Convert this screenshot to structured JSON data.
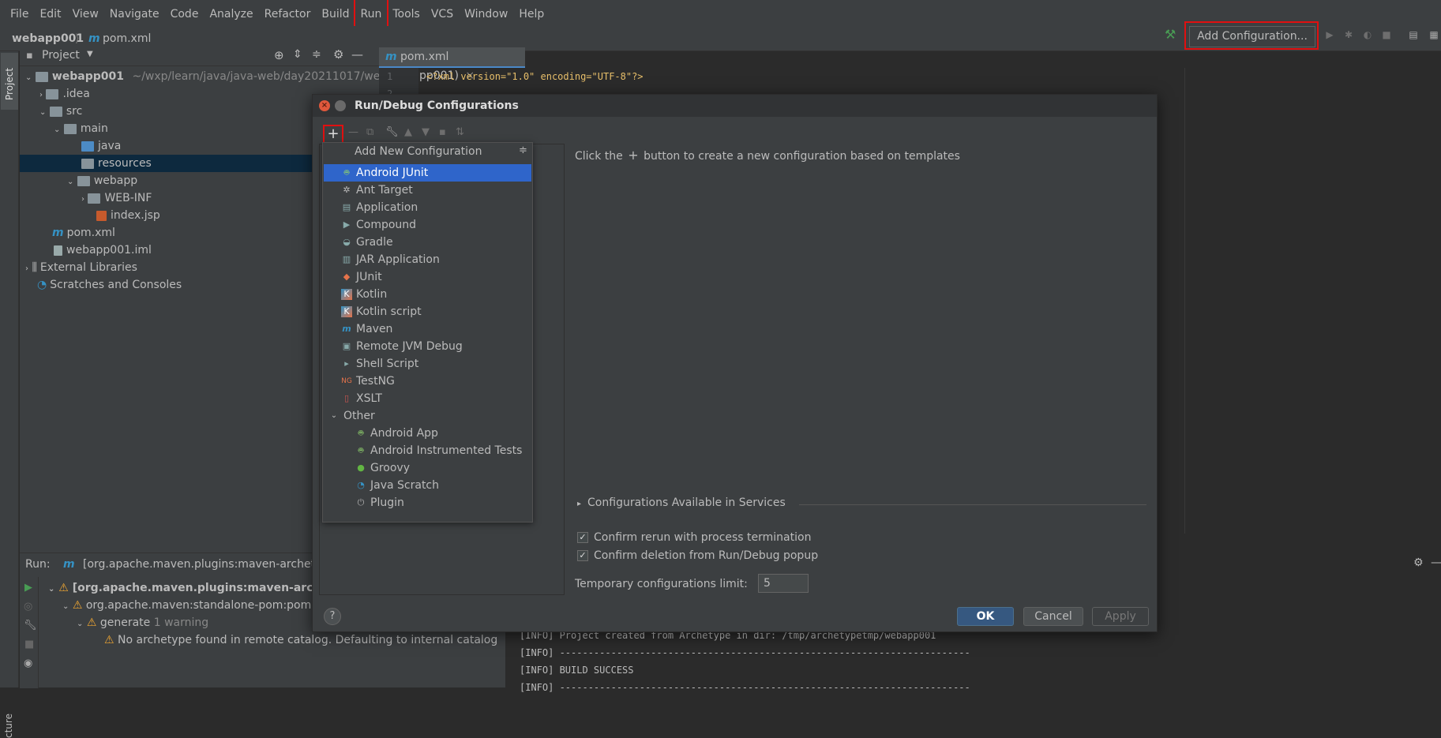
{
  "menubar": {
    "items": [
      "File",
      "Edit",
      "View",
      "Navigate",
      "Code",
      "Analyze",
      "Refactor",
      "Build",
      "Run",
      "Tools",
      "VCS",
      "Window",
      "Help"
    ]
  },
  "breadcrumb": {
    "project": "webapp001",
    "file": "pom.xml"
  },
  "toolbar": {
    "add_configuration": "Add Configuration..."
  },
  "project_panel": {
    "title": "Project",
    "root_name": "webapp001",
    "root_path": "~/wxp/learn/java/java-web/day20211017/weba",
    "items": [
      ".idea",
      "src",
      "main",
      "java",
      "resources",
      "webapp",
      "WEB-INF",
      "index.jsp",
      "pom.xml",
      "webapp001.iml",
      "External Libraries",
      "Scratches and Consoles"
    ]
  },
  "left_strip": {
    "project_tab": "Project",
    "structure_tab": "cture"
  },
  "editor": {
    "tab": "pom.xml (webapp001)",
    "line_numbers": [
      "1",
      "2"
    ],
    "line1": "<?xml version=\"1.0\" encoding=\"UTF-8\"?>"
  },
  "dialog": {
    "title": "Run/Debug Configurations",
    "hint_prefix": "Click the",
    "hint_suffix": "button to create a new configuration based on templates",
    "popup_title": "Add New Configuration",
    "items": [
      "Android JUnit",
      "Ant Target",
      "Application",
      "Compound",
      "Gradle",
      "JAR Application",
      "JUnit",
      "Kotlin",
      "Kotlin script",
      "Maven",
      "Remote JVM Debug",
      "Shell Script",
      "TestNG",
      "XSLT"
    ],
    "other_label": "Other",
    "other_items": [
      "Android App",
      "Android Instrumented Tests",
      "Groovy",
      "Java Scratch",
      "Plugin"
    ],
    "services_label": "Configurations Available in Services",
    "confirm_rerun": "Confirm rerun with process termination",
    "confirm_deletion": "Confirm deletion from Run/Debug popup",
    "temp_limit_label": "Temporary configurations limit:",
    "temp_limit_value": "5",
    "ok": "OK",
    "cancel": "Cancel",
    "apply": "Apply",
    "help": "?"
  },
  "run_panel": {
    "label": "Run:",
    "tab": "[org.apache.maven.plugins:maven-archety",
    "row1": "[org.apache.maven.plugins:maven-archet",
    "row2": "org.apache.maven:standalone-pom:pom",
    "row3": "generate",
    "row3_warn": "1 warning",
    "row4": "No archetype found in remote catalog. Defaulting to internal catalog"
  },
  "console": {
    "lines": [
      "[INFO] Project created from Archetype in dir: /tmp/archetypetmp/webapp001",
      "[INFO] ------------------------------------------------------------------------",
      "[INFO] BUILD SUCCESS",
      "[INFO] ------------------------------------------------------------------------"
    ]
  },
  "colors": {
    "accent": "#2f65ca",
    "highlight": "#e01010",
    "bg": "#2b2b2b",
    "panel": "#3c3f41"
  }
}
